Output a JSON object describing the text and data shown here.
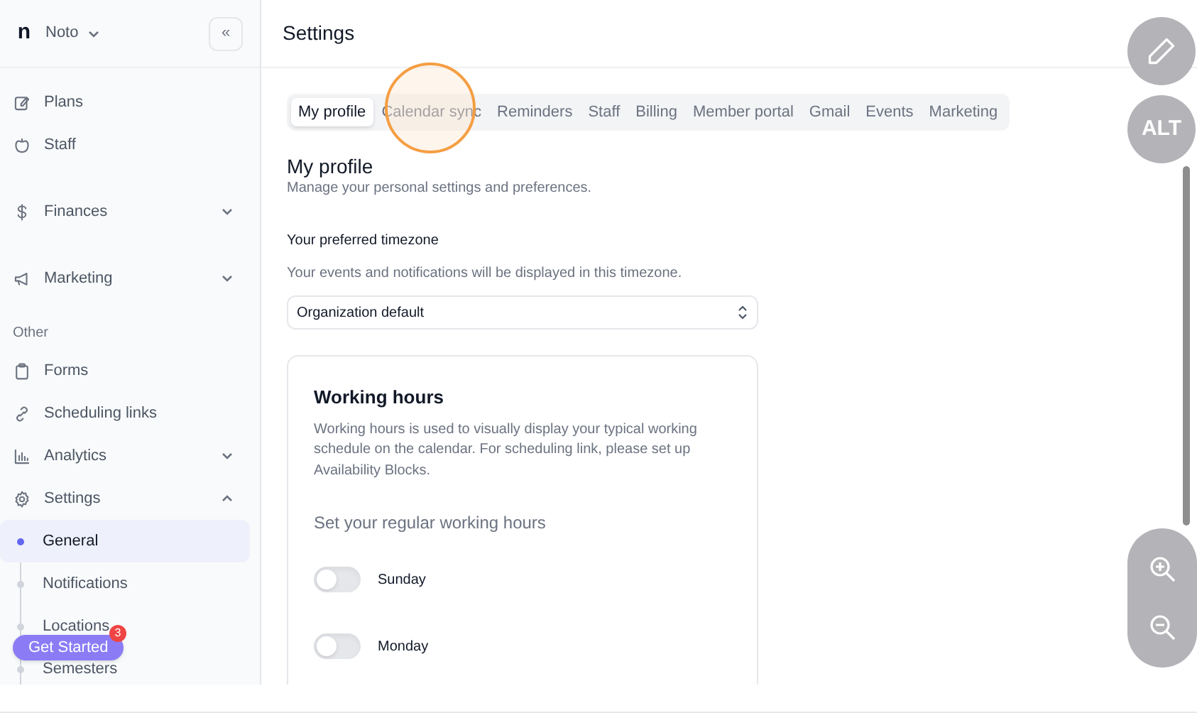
{
  "sidebar": {
    "workspace": {
      "logo": "n",
      "name": "Noto"
    },
    "collapse_button": "«",
    "items": [
      {
        "kind": "link",
        "label": "Plans"
      },
      {
        "kind": "link",
        "label": "Staff"
      },
      {
        "kind": "group",
        "label": "Finances",
        "expanded": false
      },
      {
        "kind": "group",
        "label": "Marketing",
        "expanded": false
      },
      {
        "kind": "section",
        "label": "Other"
      },
      {
        "kind": "link",
        "label": "Forms"
      },
      {
        "kind": "link",
        "label": "Scheduling links"
      },
      {
        "kind": "group",
        "label": "Analytics",
        "expanded": false
      },
      {
        "kind": "group",
        "label": "Settings",
        "expanded": true,
        "children": [
          {
            "label": "General",
            "selected": true
          },
          {
            "label": "Notifications",
            "selected": false
          },
          {
            "label": "Locations",
            "selected": false
          },
          {
            "label": "Semesters",
            "selected": false
          }
        ]
      }
    ],
    "get_started": {
      "label": "Get Started",
      "badge": "3"
    }
  },
  "page": {
    "title": "Settings"
  },
  "tabs": [
    {
      "label": "My profile",
      "selected": true
    },
    {
      "label": "Calendar sync",
      "selected": false
    },
    {
      "label": "Reminders",
      "selected": false
    },
    {
      "label": "Staff",
      "selected": false
    },
    {
      "label": "Billing",
      "selected": false
    },
    {
      "label": "Member portal",
      "selected": false
    },
    {
      "label": "Gmail",
      "selected": false
    },
    {
      "label": "Events",
      "selected": false
    },
    {
      "label": "Marketing",
      "selected": false
    }
  ],
  "profile": {
    "title": "My profile",
    "subtitle": "Manage your personal settings and preferences.",
    "timezone_label": "Your preferred timezone",
    "timezone_help": "Your events and notifications will be displayed in this timezone.",
    "timezone_value": "Organization default"
  },
  "working_hours": {
    "title": "Working hours",
    "description": "Working hours is used to visually display your typical working schedule on the calendar. For scheduling link, please set up Availability Blocks.",
    "prompt": "Set your regular working hours",
    "days": [
      {
        "label": "Sunday",
        "on": false
      },
      {
        "label": "Monday",
        "on": false
      }
    ]
  },
  "floating_tools": {
    "alt_label": "ALT"
  }
}
